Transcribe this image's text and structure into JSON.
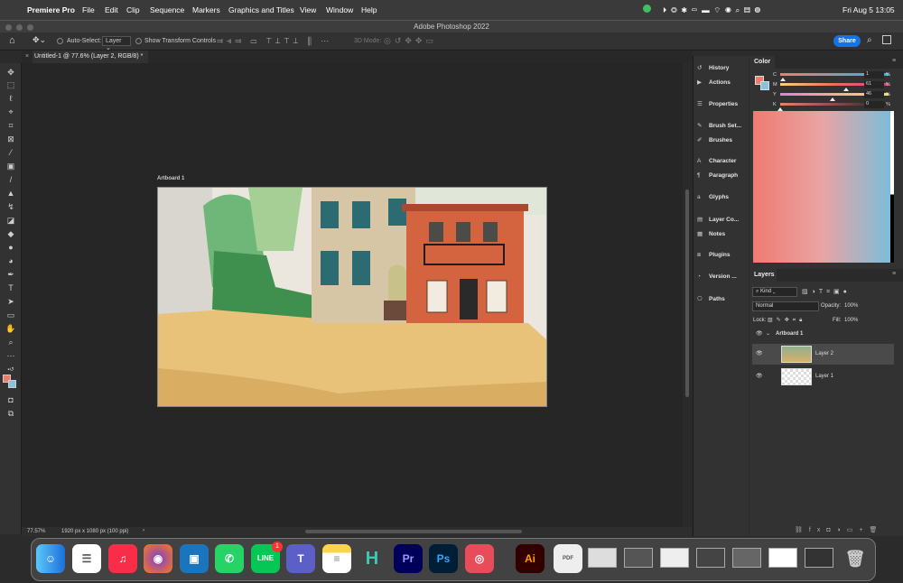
{
  "menubar": {
    "app": "Premiere Pro",
    "menus": [
      "File",
      "Edit",
      "Clip",
      "Sequence",
      "Markers",
      "Graphics and Titles",
      "View",
      "Window",
      "Help"
    ],
    "clock": "Fri Aug 5  13:05"
  },
  "window": {
    "title": "Adobe Photoshop 2022"
  },
  "options": {
    "autoselect": "Auto-Select:",
    "autoselect_value": "Layer",
    "transform": "Show Transform Controls",
    "mode3d": "3D Mode:",
    "share": "Share"
  },
  "document": {
    "tab": "Untitled-1 @ 77.6% (Layer 2, RGB/8) *",
    "artboard": "Artboard 1"
  },
  "status": {
    "zoom": "77.57%",
    "info": "1920 px x 1080 px (100 ppi)"
  },
  "collapsed_panels": [
    "History",
    "Actions",
    "Properties",
    "Brush Set...",
    "Brushes",
    "Character",
    "Paragraph",
    "Glyphs",
    "Layer Co...",
    "Notes",
    "Plugins",
    "Version ...",
    "Paths"
  ],
  "color": {
    "title": "Color",
    "channels": [
      {
        "label": "C",
        "value": "1"
      },
      {
        "label": "M",
        "value": "61"
      },
      {
        "label": "Y",
        "value": "46"
      },
      {
        "label": "K",
        "value": "0"
      }
    ],
    "unit": "%",
    "foreground": "#ef7b6f",
    "background": "#89c2dc"
  },
  "layers": {
    "title": "Layers",
    "filter": "Kind",
    "blend": "Normal",
    "opacity_label": "Opacity:",
    "opacity": "100%",
    "lock_label": "Lock:",
    "fill_label": "Fill:",
    "fill": "100%",
    "artboard": "Artboard 1",
    "items": [
      "Layer 2",
      "Layer 1"
    ]
  },
  "dock": {
    "apps": [
      "Finder",
      "Reminders",
      "Music",
      "Firefox",
      "Screens",
      "WhatsApp",
      "LINE",
      "Teams",
      "Notes",
      "Hype",
      "Pr",
      "Ps",
      "Linea",
      "Ai"
    ],
    "line_badge": "1"
  }
}
